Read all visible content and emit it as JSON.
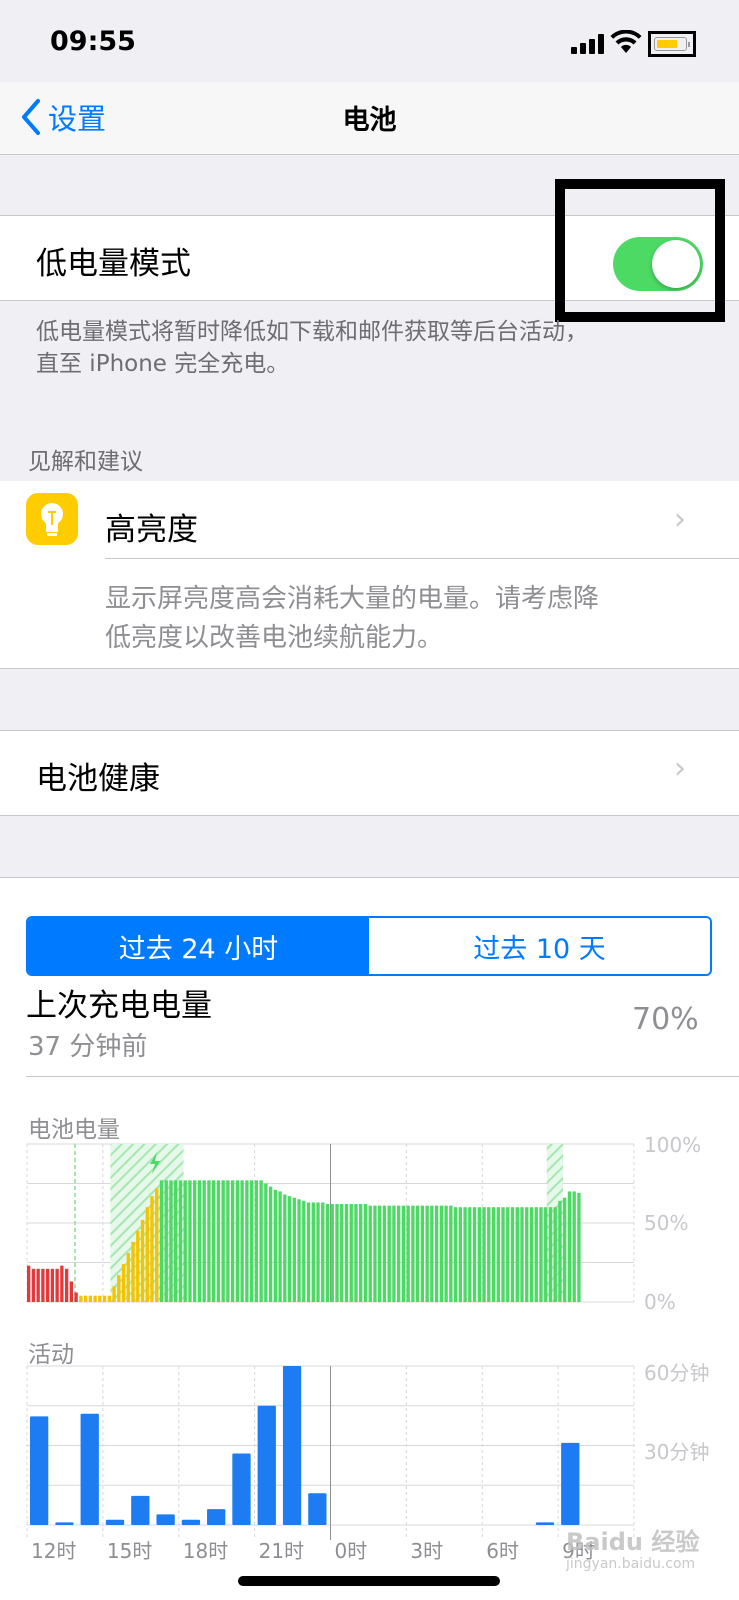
{
  "status_bar": {
    "time": "09:55"
  },
  "nav": {
    "back_label": "设置",
    "title": "电池"
  },
  "low_power": {
    "label": "低电量模式",
    "enabled": true,
    "description_line1": "低电量模式将暂时降低如下载和邮件获取等后台活动，",
    "description_line2": "直至 iPhone 完全充电。"
  },
  "insights": {
    "header": "见解和建议",
    "item_title": "高亮度",
    "item_desc_line1": "显示屏亮度高会消耗大量的电量。请考虑降",
    "item_desc_line2": "低亮度以改善电池续航能力。"
  },
  "battery_health": {
    "label": "电池健康"
  },
  "usage": {
    "segments": [
      "过去 24 小时",
      "过去 10 天"
    ],
    "selected_segment": 0,
    "last_charge_title": "上次充电电量",
    "last_charge_time": "37 分钟前",
    "last_charge_value": "70%"
  },
  "chart_data": [
    {
      "type": "bar",
      "title": "电池电量",
      "y_ticks": [
        "100%",
        "50%",
        "0%"
      ],
      "ylim": [
        0,
        100
      ],
      "grid": true,
      "values": [
        23,
        21,
        21,
        21,
        21,
        21,
        21,
        23,
        21,
        13,
        6,
        4,
        4,
        4,
        4,
        4,
        4,
        4,
        10,
        17,
        24,
        31,
        38,
        45,
        52,
        60,
        67,
        72,
        77,
        77,
        77,
        77,
        77,
        77,
        77,
        77,
        77,
        77,
        77,
        77,
        77,
        77,
        77,
        77,
        77,
        77,
        77,
        77,
        77,
        77,
        75,
        73,
        71,
        70,
        68,
        67,
        66,
        65,
        64,
        63,
        63,
        63,
        63,
        62,
        62,
        62,
        62,
        62,
        62,
        62,
        62,
        62,
        61,
        61,
        61,
        61,
        61,
        61,
        61,
        61,
        61,
        61,
        61,
        61,
        61,
        61,
        61,
        61,
        61,
        61,
        60,
        60,
        60,
        60,
        60,
        60,
        60,
        60,
        60,
        60,
        60,
        60,
        60,
        60,
        60,
        60,
        60,
        60,
        60,
        60,
        60,
        60,
        64,
        66,
        70,
        70,
        69
      ],
      "color_states": {
        "low": "#e5383b",
        "charging": "#f5c400",
        "normal": "#4cd964"
      }
    },
    {
      "type": "bar",
      "title": "活动",
      "y_ticks": [
        "60分钟",
        "30分钟"
      ],
      "ylim": [
        0,
        60
      ],
      "grid": true,
      "x_tick_labels": [
        "12时",
        "15时",
        "18时",
        "21时",
        "0时",
        "3时",
        "6时",
        "9时"
      ],
      "values": [
        41,
        1,
        42,
        2,
        11,
        4,
        2,
        6,
        27,
        45,
        60,
        12,
        0,
        0,
        0,
        0,
        0,
        0,
        0,
        0,
        1,
        31
      ],
      "color": "#1e7cf2"
    }
  ],
  "watermark": {
    "line1": "Baidu 经验",
    "line2": "jingyan.baidu.com"
  }
}
